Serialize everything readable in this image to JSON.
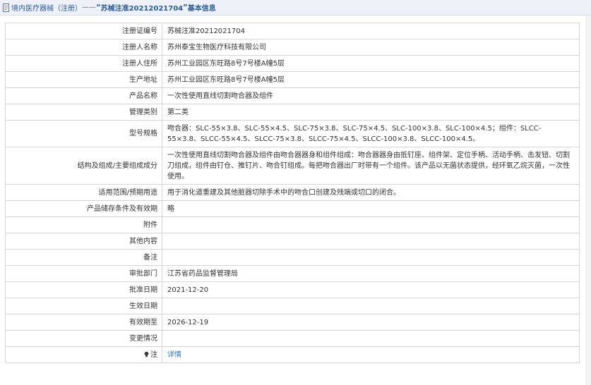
{
  "header": {
    "crumb_a": "境内医疗器械（注册）",
    "dash": "——",
    "quote_open": "“",
    "reg_no": "苏械注准20212021704",
    "quote_close": "”",
    "suffix": "基本信息"
  },
  "rows": [
    {
      "label": "注册证编号",
      "value": "苏械注准20212021704"
    },
    {
      "label": "注册人名称",
      "value": "苏州泰宝生物医疗科技有限公司"
    },
    {
      "label": "注册人住所",
      "value": "苏州工业园区东旺路8号7号楼A幢5层"
    },
    {
      "label": "生产地址",
      "value": "苏州工业园区东旺路8号7号楼A幢5层"
    },
    {
      "label": "产品名称",
      "value": "一次性使用直线切割吻合器及组件"
    },
    {
      "label": "管理类别",
      "value": "第二类"
    },
    {
      "label": "型号规格",
      "value": "吻合器：SLC-55×3.8、SLC-55×4.5、SLC-75×3.8、SLC-75×4.5、SLC-100×3.8、SLC-100×4.5；组件：SLCC-55×3.8、SLCC-55×4.5、SLCC-75×3.8、SLCC-75×4.5、SLCC-100×3.8、SLCC-100×4.5。"
    },
    {
      "label": "结构及组成/主要组成成分",
      "value": "一次性使用直线切割吻合器及组件由吻合器器身和组件组成：吻合器器身由抵钉座、组件架、定位手柄、活动手柄、击发钮、切割刀组成，组件由钉仓、推钉片、吻合钉组成。每把吻合器出厂时带有一个组件。该产品以无菌状态提供，经环氧乙烷灭菌，一次性使用。"
    },
    {
      "label": "适用范围/预期用途",
      "value": "用于消化道重建及其他脏器切除手术中的吻合口创建及残端或切口的闭合。"
    },
    {
      "label": "产品储存条件及有效期",
      "value": "略"
    },
    {
      "label": "附件",
      "value": ""
    },
    {
      "label": "其他内容",
      "value": ""
    },
    {
      "label": "备注",
      "value": ""
    },
    {
      "label": "审批部门",
      "value": "江苏省药品监督管理局"
    },
    {
      "label": "批准日期",
      "value": "2021-12-20"
    },
    {
      "label": "生效日期",
      "value": ""
    },
    {
      "label": "有效期至",
      "value": "2026-12-19"
    },
    {
      "label": "变更情况",
      "value": ""
    }
  ],
  "note_row": {
    "label": "注",
    "link": "详情"
  }
}
